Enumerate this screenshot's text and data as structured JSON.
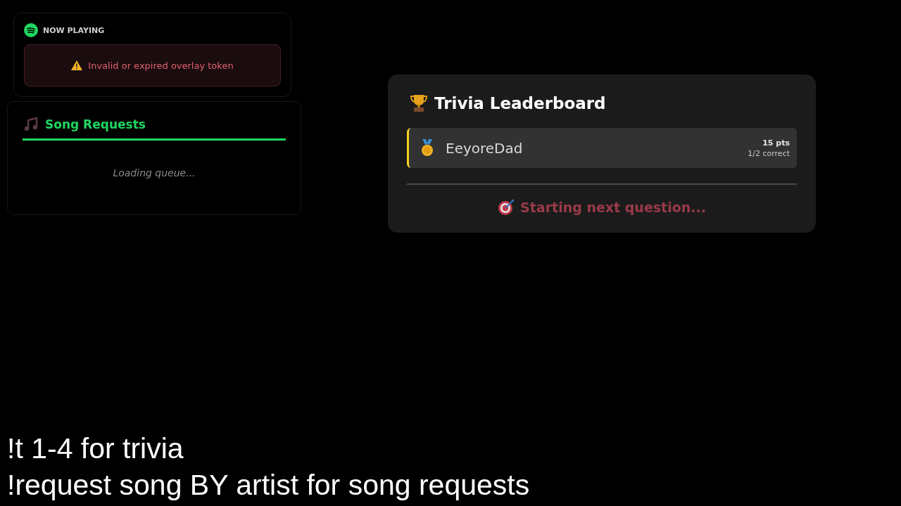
{
  "now_playing": {
    "title": "NOW PLAYING",
    "error": "Invalid or expired overlay token"
  },
  "song_requests": {
    "title": "Song Requests",
    "status": "Loading queue..."
  },
  "leaderboard": {
    "title": "Trivia Leaderboard",
    "entries": [
      {
        "name": "EeyoreDad",
        "points": "15 pts",
        "correct": "1/2 correct"
      }
    ],
    "status": "Starting next question..."
  },
  "instructions": [
    "!t 1-4 for trivia",
    "!request song BY artist for song requests"
  ]
}
